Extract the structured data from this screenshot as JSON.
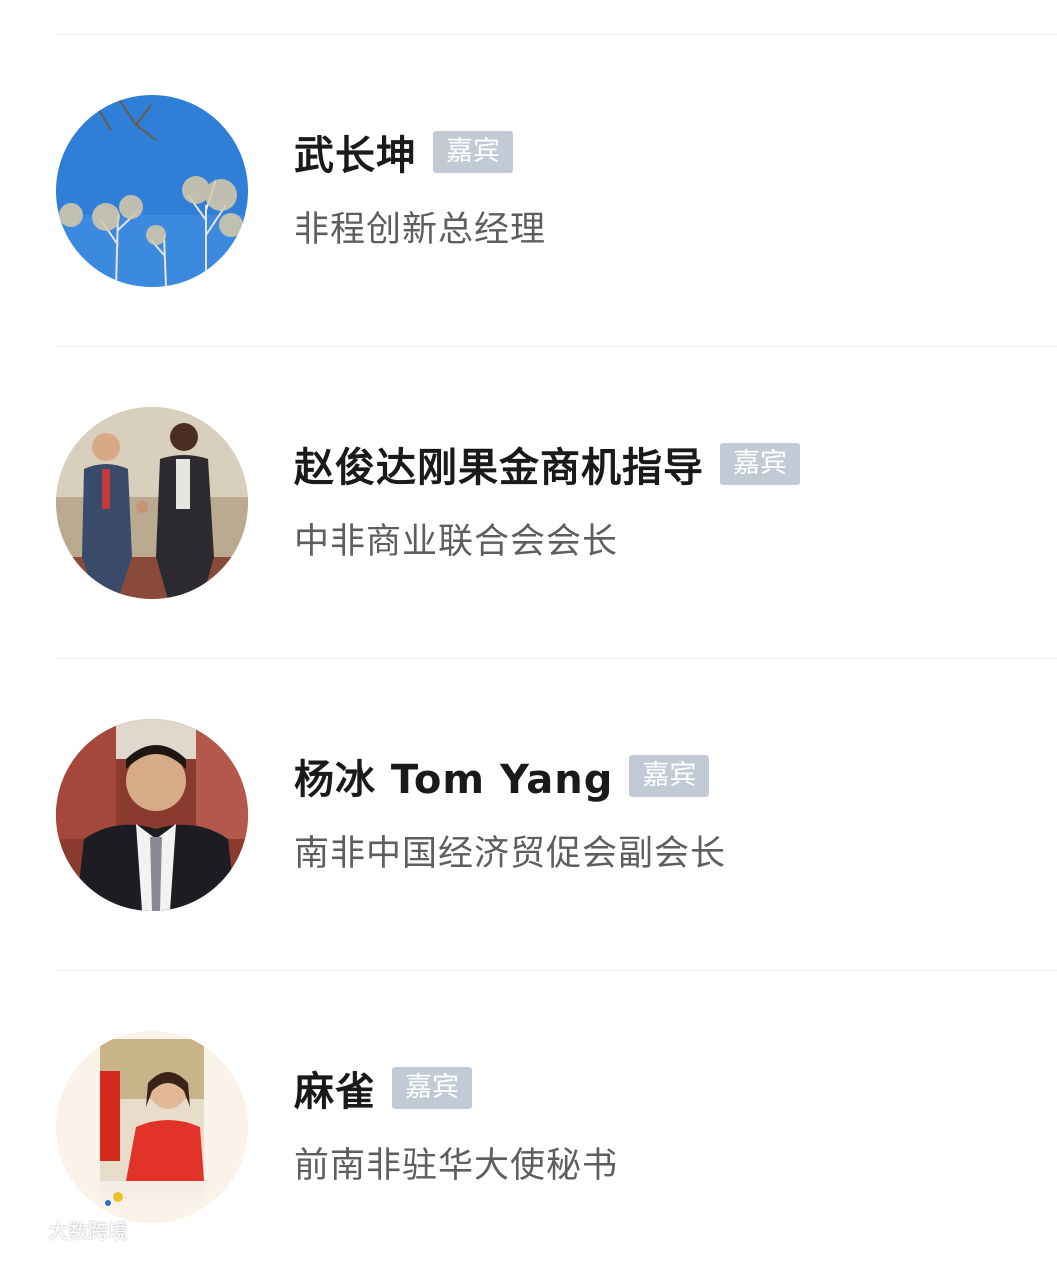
{
  "guests": [
    {
      "name": "武长坤",
      "badge": "嘉宾",
      "title": "非程创新总经理",
      "avatar_icon": "avatar-trees-blue-sky"
    },
    {
      "name": "赵俊达刚果金商机指导",
      "badge": "嘉宾",
      "title": "中非商业联合会会长",
      "avatar_icon": "avatar-two-men-handshake"
    },
    {
      "name": "杨冰 Tom Yang",
      "badge": "嘉宾",
      "title": "南非中国经济贸促会副会长",
      "avatar_icon": "avatar-man-in-suit"
    },
    {
      "name": "麻雀",
      "badge": "嘉宾",
      "title": "前南非驻华大使秘书",
      "avatar_icon": "avatar-woman-red-top"
    }
  ],
  "watermark": {
    "text": "大数跨境"
  },
  "colors": {
    "badge_bg": "#c2cbd5",
    "name": "#1a1a1a",
    "title": "#5e5e5e",
    "divider": "#ececec"
  }
}
